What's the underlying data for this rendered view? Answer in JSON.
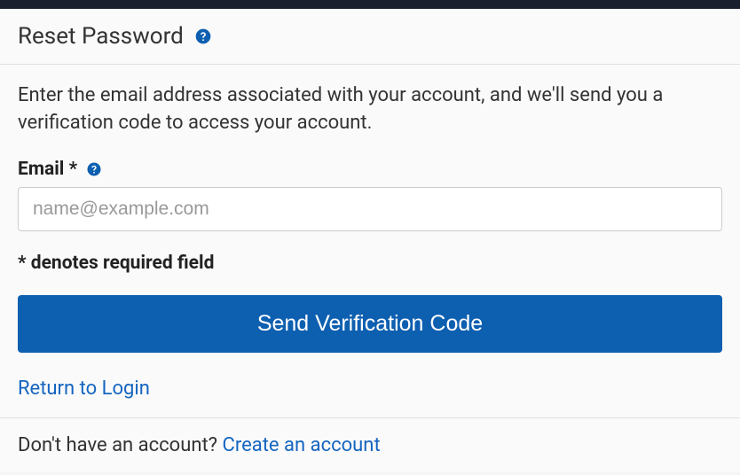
{
  "header": {
    "title": "Reset Password"
  },
  "content": {
    "description": "Enter the email address associated with your account, and we'll send you a verification code to access your account.",
    "email_label": "Email *",
    "email_placeholder": "name@example.com",
    "required_note": "* denotes required field",
    "submit_label": "Send Verification Code",
    "return_link": "Return to Login"
  },
  "footer": {
    "prompt": "Don't have an account? ",
    "create_link": "Create an account"
  }
}
